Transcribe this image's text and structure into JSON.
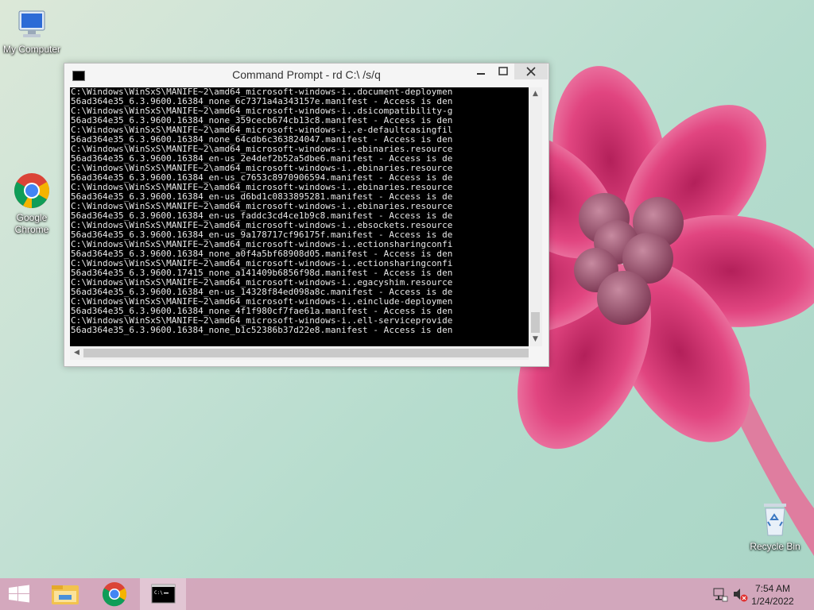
{
  "desktop": {
    "icons": [
      {
        "label": "My Computer"
      },
      {
        "label": "Google Chrome"
      },
      {
        "label": "Recycle Bin"
      }
    ]
  },
  "window": {
    "title": "Command Prompt - rd  C:\\ /s/q",
    "console_lines": [
      "C:\\Windows\\WinSxS\\MANIFE~2\\amd64_microsoft-windows-i..document-deploymen",
      "56ad364e35_6.3.9600.16384_none_6c7371a4a343157e.manifest - Access is den",
      "C:\\Windows\\WinSxS\\MANIFE~2\\amd64_microsoft-windows-i..dsicompatibility-g",
      "56ad364e35_6.3.9600.16384_none_359cecb674cb13c8.manifest - Access is den",
      "C:\\Windows\\WinSxS\\MANIFE~2\\amd64_microsoft-windows-i..e-defaultcasingfil",
      "56ad364e35_6.3.9600.16384_none_64cdb6c363824047.manifest - Access is den",
      "C:\\Windows\\WinSxS\\MANIFE~2\\amd64_microsoft-windows-i..ebinaries.resource",
      "56ad364e35_6.3.9600.16384_en-us_2e4def2b52a5dbe6.manifest - Access is de",
      "C:\\Windows\\WinSxS\\MANIFE~2\\amd64_microsoft-windows-i..ebinaries.resource",
      "56ad364e35_6.3.9600.16384_en-us_c7653c8970906594.manifest - Access is de",
      "C:\\Windows\\WinSxS\\MANIFE~2\\amd64_microsoft-windows-i..ebinaries.resource",
      "56ad364e35_6.3.9600.16384_en-us_d6bd1c0833895281.manifest - Access is de",
      "C:\\Windows\\WinSxS\\MANIFE~2\\amd64_microsoft-windows-i..ebinaries.resource",
      "56ad364e35_6.3.9600.16384_en-us_faddc3cd4ce1b9c8.manifest - Access is de",
      "C:\\Windows\\WinSxS\\MANIFE~2\\amd64_microsoft-windows-i..ebsockets.resource",
      "56ad364e35_6.3.9600.16384_en-us_9a178717cf96175f.manifest - Access is de",
      "C:\\Windows\\WinSxS\\MANIFE~2\\amd64_microsoft-windows-i..ectionsharingconfi",
      "56ad364e35_6.3.9600.16384_none_a0f4a5bf68908d05.manifest - Access is den",
      "C:\\Windows\\WinSxS\\MANIFE~2\\amd64_microsoft-windows-i..ectionsharingconfi",
      "56ad364e35_6.3.9600.17415_none_a141409b6856f98d.manifest - Access is den",
      "C:\\Windows\\WinSxS\\MANIFE~2\\amd64_microsoft-windows-i..egacyshim.resource",
      "56ad364e35_6.3.9600.16384_en-us_14328f84ed098a8c.manifest - Access is de",
      "C:\\Windows\\WinSxS\\MANIFE~2\\amd64_microsoft-windows-i..einclude-deploymen",
      "56ad364e35_6.3.9600.16384_none_4f1f980cf7fae61a.manifest - Access is den",
      "C:\\Windows\\WinSxS\\MANIFE~2\\amd64_microsoft-windows-i..ell-serviceprovide",
      "56ad364e35_6.3.9600.16384_none_b1c52386b37d22e8.manifest - Access is den"
    ]
  },
  "tray": {
    "time": "7:54 AM",
    "date": "1/24/2022"
  },
  "colors": {
    "taskbar": "#d6a2ba",
    "flower": "#e8457e",
    "console_bg": "#000000",
    "console_text": "#e8e8e8"
  }
}
